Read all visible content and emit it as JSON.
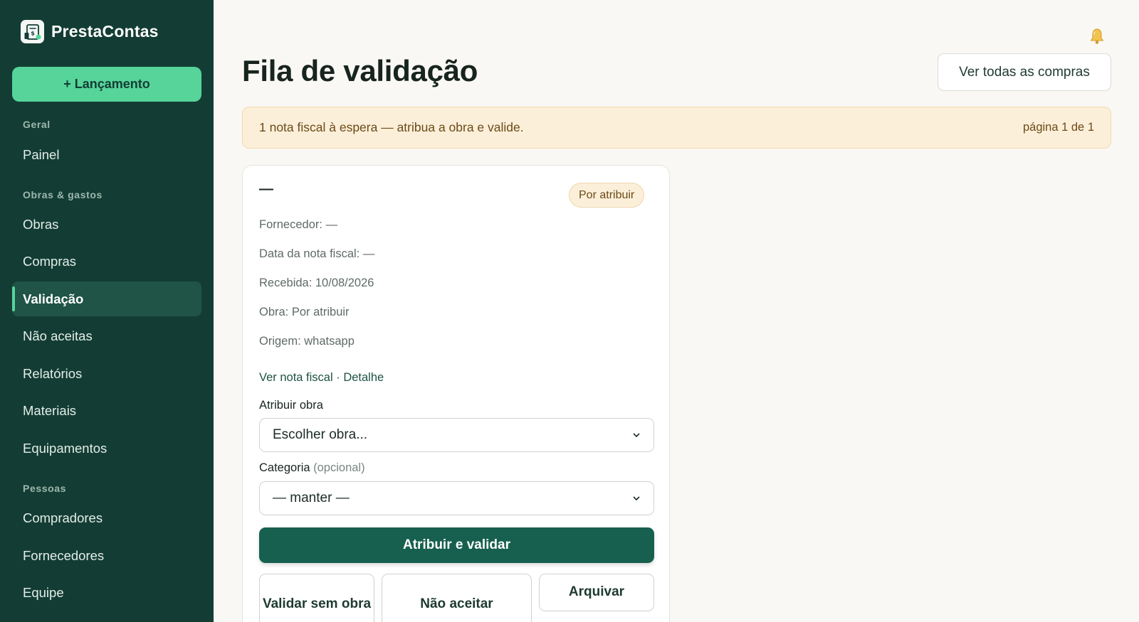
{
  "app": {
    "name": "PrestaContas",
    "new_entry_label": "+ Lançamento"
  },
  "sidebar": {
    "sections": {
      "geral": "Geral",
      "obras_gastos": "Obras & gastos",
      "pessoas": "Pessoas"
    },
    "items": [
      {
        "label": "Painel",
        "active": false
      },
      {
        "label": "Obras",
        "active": false
      },
      {
        "label": "Compras",
        "active": false
      },
      {
        "label": "Validação",
        "active": true
      },
      {
        "label": "Não aceitas",
        "active": false
      },
      {
        "label": "Relatórios",
        "active": false
      },
      {
        "label": "Materiais",
        "active": false
      },
      {
        "label": "Equipamentos",
        "active": false
      },
      {
        "label": "Compradores",
        "active": false
      },
      {
        "label": "Fornecedores",
        "active": false
      },
      {
        "label": "Equipe",
        "active": false
      }
    ]
  },
  "header": {
    "title": "Fila de validação",
    "view_all_label": "Ver todas as compras"
  },
  "banner": {
    "message": "1 nota fiscal à espera — atribua a obra e valide.",
    "pagination": "página 1 de 1"
  },
  "card": {
    "identifier": "—",
    "status": "Por atribuir",
    "supplier": "Fornecedor: —",
    "invoice_date": "Data da nota fiscal: —",
    "received": "Recebida: 10/08/2026",
    "project": "Obra: Por atribuir",
    "origin": "Origem: whatsapp",
    "link_view_invoice": "Ver nota fiscal",
    "link_separator": "·",
    "link_detail": "Detalhe",
    "assign_label": "Atribuir obra",
    "assign_value": "Escolher obra...",
    "category_label": "Categoria",
    "category_optional": "(opcional)",
    "category_value": "— manter —",
    "primary_action": "Atribuir e validar",
    "validate_without_label": "Validar sem obra",
    "reject_label": "Não aceitar",
    "archive_label": "Arquivar"
  },
  "colors": {
    "sidebar_bg": "#133d34",
    "accent_green": "#56d49a",
    "primary_button": "#17604f",
    "banner_bg": "#fcefd9",
    "page_bg": "#faf8f4"
  },
  "icons": {
    "logo": "receipt-logo-icon",
    "bell": "bell-icon",
    "select_chevron": "chevron-down-icon"
  }
}
